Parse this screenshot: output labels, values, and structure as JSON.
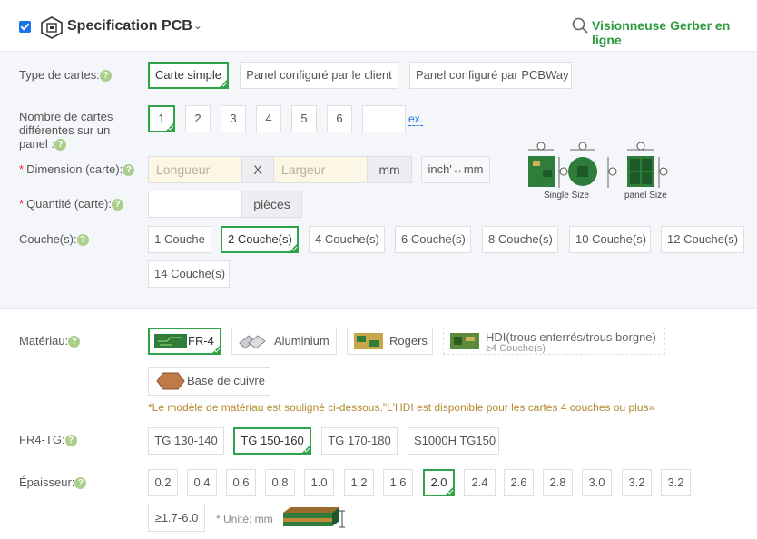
{
  "header": {
    "title": "Specification PCB",
    "gerber_link": "Visionneuse Gerber en ligne",
    "accent": "#2e9a3e"
  },
  "board_type": {
    "label": "Type de cartes:",
    "options": [
      "Carte simple",
      "Panel configuré par le client",
      "Panel configuré par PCBWay"
    ],
    "selected": "Carte simple"
  },
  "designs": {
    "label": "Nombre de cartes différentes sur un panel :",
    "options": [
      "1",
      "2",
      "3",
      "4",
      "5",
      "6"
    ],
    "selected": "1",
    "custom_value": "",
    "ex_link": "ex."
  },
  "dimension": {
    "label": "Dimension (carte):",
    "length_placeholder": "Longueur",
    "separator": "X",
    "width_placeholder": "Largeur",
    "unit": "mm",
    "convert_button": "inch'↔mm",
    "diagram_single": "Single Size",
    "diagram_panel": "panel Size"
  },
  "quantity": {
    "label": "Quantité (carte):",
    "value": "",
    "unit": "pièces"
  },
  "layers": {
    "label": "Couche(s):",
    "options": [
      "1 Couche",
      "2 Couche(s)",
      "4 Couche(s)",
      "6 Couche(s)",
      "8 Couche(s)",
      "10 Couche(s)",
      "12 Couche(s)",
      "14 Couche(s)"
    ],
    "selected": "2 Couche(s)"
  },
  "material": {
    "label": "Matériau:",
    "options": [
      "FR-4",
      "Aluminium",
      "Rogers",
      "HDI(trous enterrés/trous borgne)",
      "Base de cuivre"
    ],
    "hdi_sub": "≥4 Couche(s)",
    "selected": "FR-4",
    "note": "*Le modèle de matériau est souligné ci-dessous.\"L'HDI est disponible pour les cartes 4 couches ou plus»"
  },
  "tg": {
    "label": "FR4-TG:",
    "options": [
      "TG 130-140",
      "TG 150-160",
      "TG 170-180",
      "S1000H TG150"
    ],
    "selected": "TG 150-160"
  },
  "thickness": {
    "label": "Épaisseur:",
    "options": [
      "0.2",
      "0.4",
      "0.6",
      "0.8",
      "1.0",
      "1.2",
      "1.6",
      "2.0",
      "2.4",
      "2.6",
      "2.8",
      "3.0",
      "3.2",
      "≥1.7-6.0"
    ],
    "selected": "1.6",
    "unit_note": "* Unité: mm"
  },
  "icons": [
    "checkbox-checked-icon",
    "pcb-chip-icon",
    "chevron-down-icon",
    "search-icon",
    "help-icon",
    "pcb-board-icon"
  ]
}
